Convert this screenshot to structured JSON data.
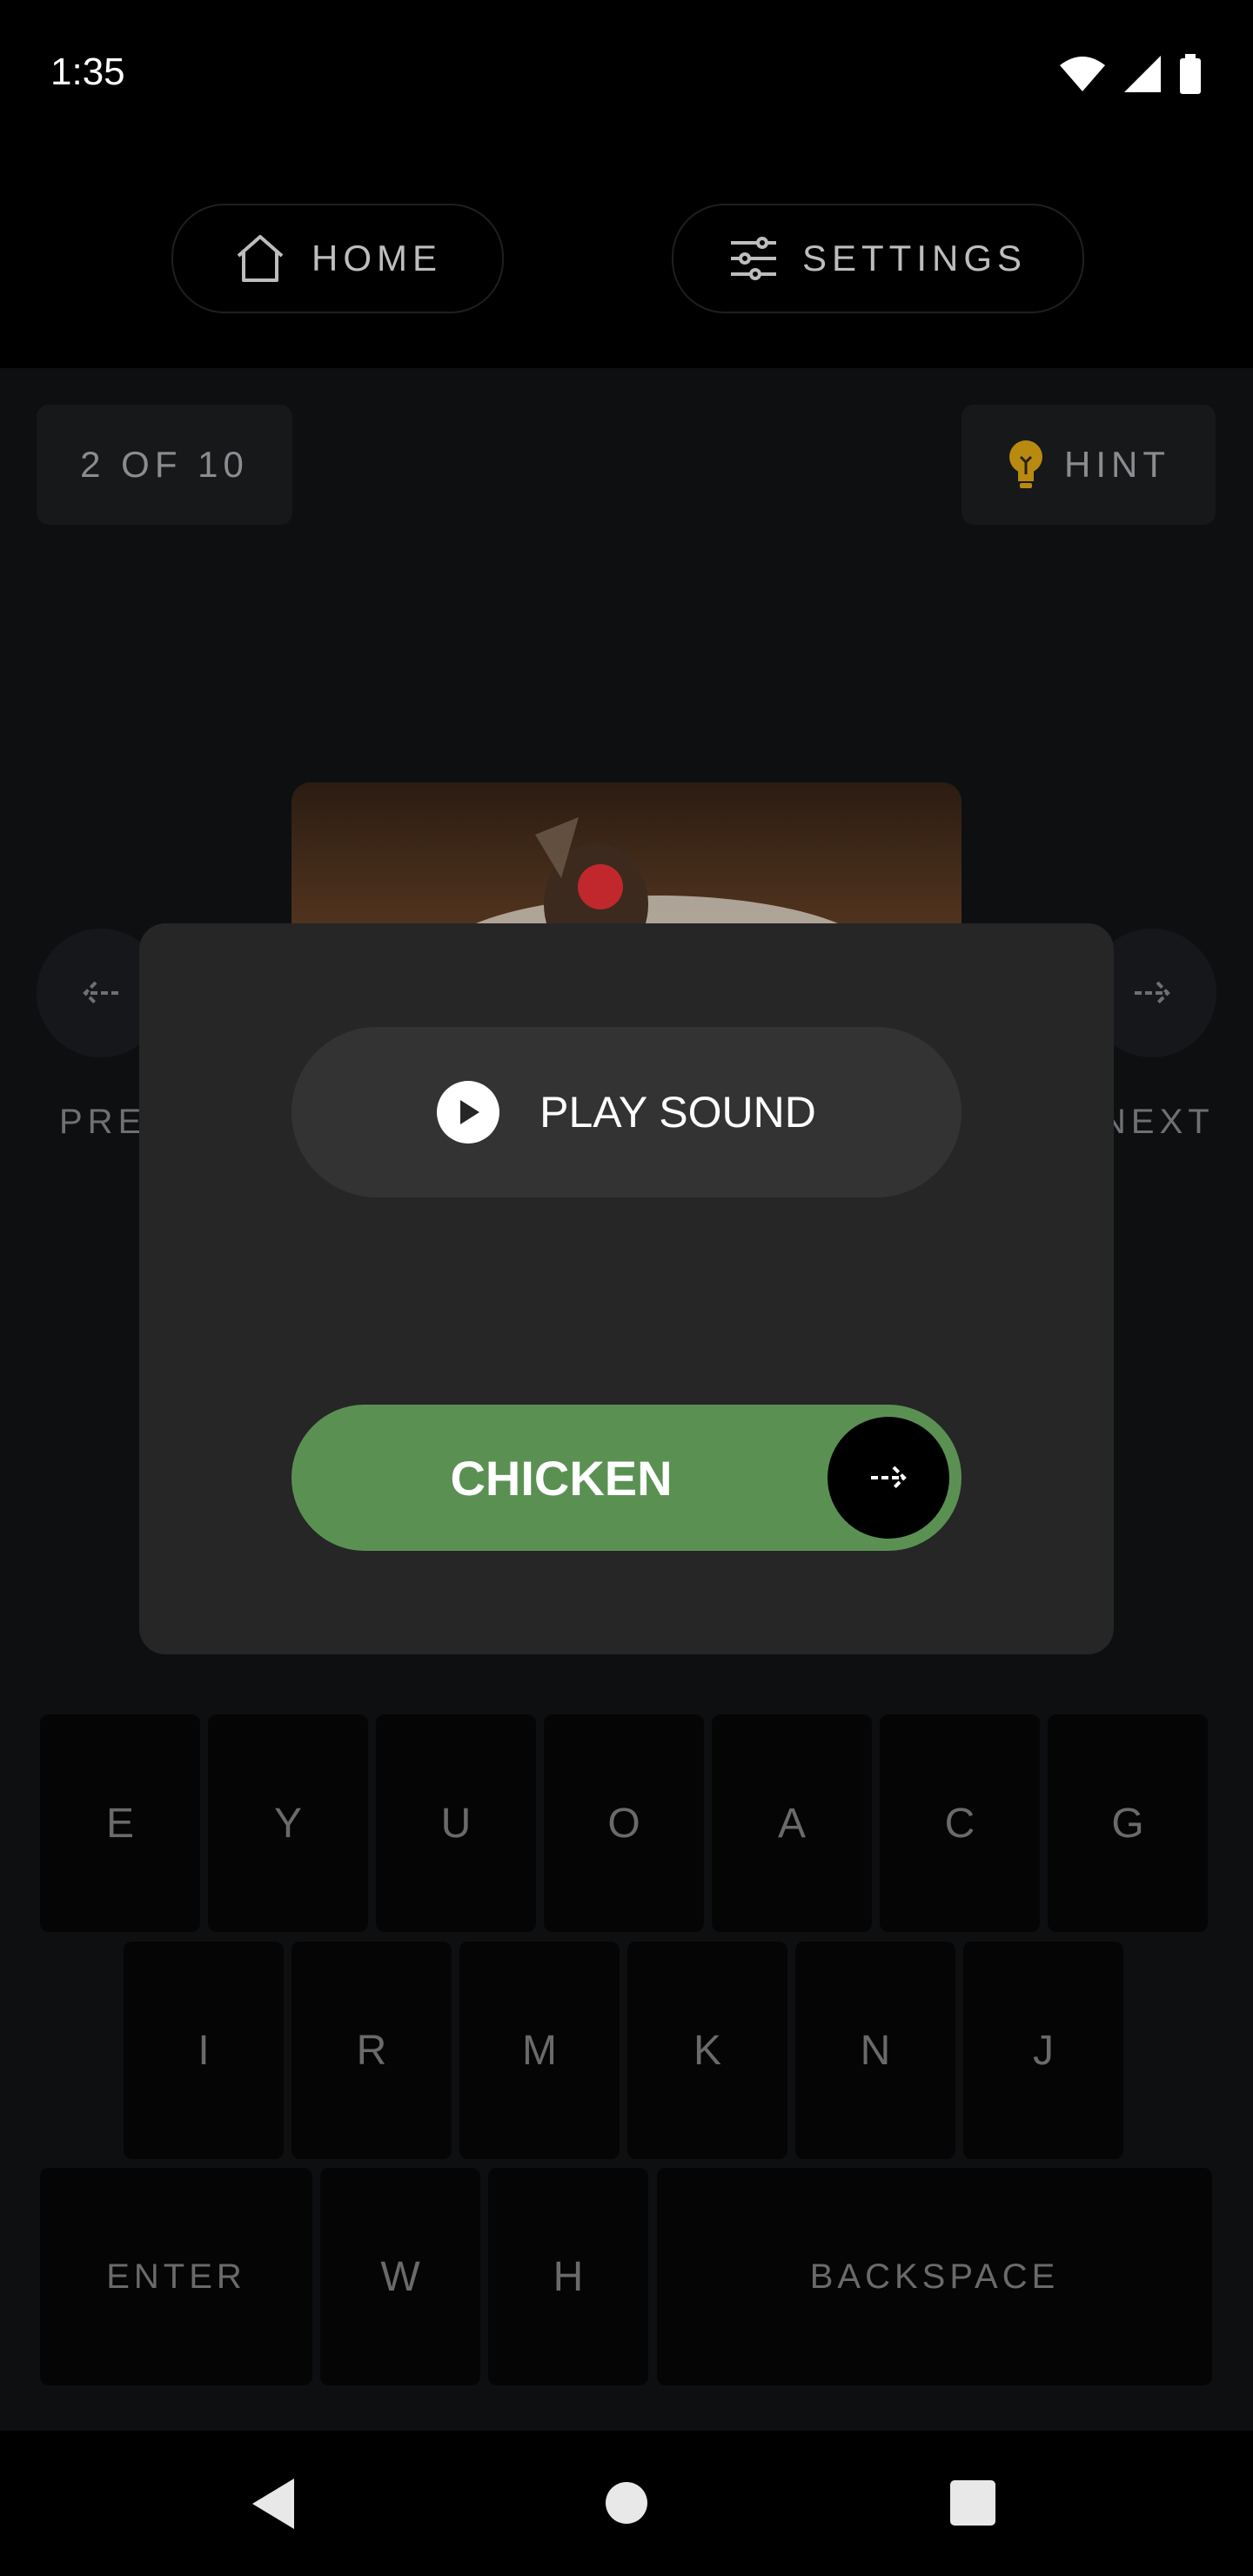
{
  "status_bar": {
    "time": "1:35"
  },
  "top_nav": {
    "home_label": "HOME",
    "settings_label": "SETTINGS"
  },
  "game": {
    "progress": "2 OF 10",
    "hint_label": "HINT",
    "prev_label": "PREV",
    "next_label": "NEXT"
  },
  "modal": {
    "play_sound_label": "PLAY SOUND",
    "answer": "CHICKEN"
  },
  "keyboard": {
    "row1": [
      "E",
      "Y",
      "U",
      "O",
      "A",
      "C",
      "G"
    ],
    "row2": [
      "I",
      "R",
      "M",
      "K",
      "N",
      "J"
    ],
    "row3": [
      "ENTER",
      "W",
      "H",
      "BACKSPACE"
    ]
  },
  "colors": {
    "answer_bg": "#5a9153",
    "hint_bulb": "#b88a10",
    "modal_bg": "#262626"
  }
}
